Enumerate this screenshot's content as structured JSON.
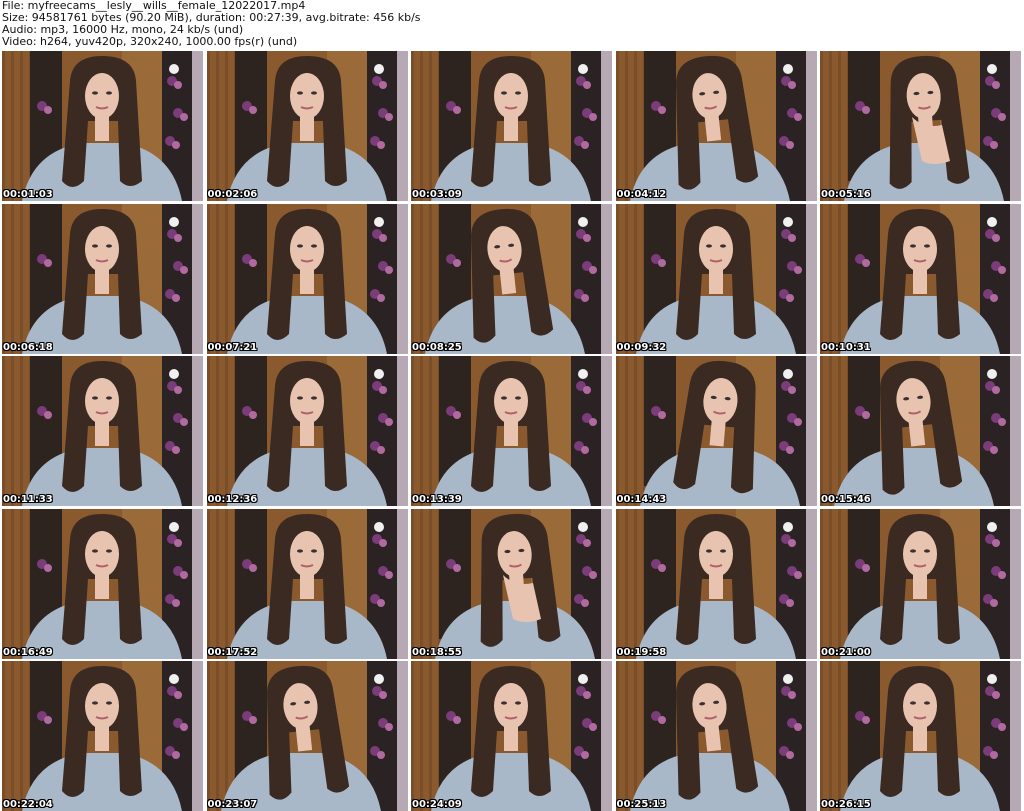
{
  "header": {
    "file": "File: myfreecams__lesly__wills__female_12022017.mp4",
    "size": "Size: 94581761 bytes (90.20 MiB), duration: 00:27:39, avg.bitrate: 456 kb/s",
    "audio": "Audio: mp3, 16000 Hz, mono, 24 kb/s (und)",
    "video": "Video: h264, yuv420p, 320x240, 1000.00 fps(r) (und)"
  },
  "colors": {
    "wood": "#8a5a2e",
    "wood_dark": "#5c3a1c",
    "cabinet": "#2d2420",
    "wall": "#d8d4d6",
    "curtain": "#b7a9b3",
    "hair": "#3b2a22",
    "skin": "#e8c4b0",
    "sweater": "#a9b8c8",
    "flowers": "#7a3d7a"
  },
  "thumbnails": [
    {
      "time": "00:01:03",
      "pose": "center"
    },
    {
      "time": "00:02:06",
      "pose": "center"
    },
    {
      "time": "00:03:09",
      "pose": "center"
    },
    {
      "time": "00:04:12",
      "pose": "tilt-left"
    },
    {
      "time": "00:05:16",
      "pose": "hand-chin"
    },
    {
      "time": "00:06:18",
      "pose": "center"
    },
    {
      "time": "00:07:21",
      "pose": "center"
    },
    {
      "time": "00:08:25",
      "pose": "tilt-left"
    },
    {
      "time": "00:09:32",
      "pose": "center"
    },
    {
      "time": "00:10:31",
      "pose": "center"
    },
    {
      "time": "00:11:33",
      "pose": "center"
    },
    {
      "time": "00:12:36",
      "pose": "center"
    },
    {
      "time": "00:13:39",
      "pose": "center"
    },
    {
      "time": "00:14:43",
      "pose": "tilt-right"
    },
    {
      "time": "00:15:46",
      "pose": "tilt-left"
    },
    {
      "time": "00:16:49",
      "pose": "center"
    },
    {
      "time": "00:17:52",
      "pose": "center"
    },
    {
      "time": "00:18:55",
      "pose": "hand-chin"
    },
    {
      "time": "00:19:58",
      "pose": "center"
    },
    {
      "time": "00:21:00",
      "pose": "center"
    },
    {
      "time": "00:22:04",
      "pose": "center"
    },
    {
      "time": "00:23:07",
      "pose": "tilt-left"
    },
    {
      "time": "00:24:09",
      "pose": "center"
    },
    {
      "time": "00:25:13",
      "pose": "tilt-left"
    },
    {
      "time": "00:26:15",
      "pose": "center"
    }
  ]
}
